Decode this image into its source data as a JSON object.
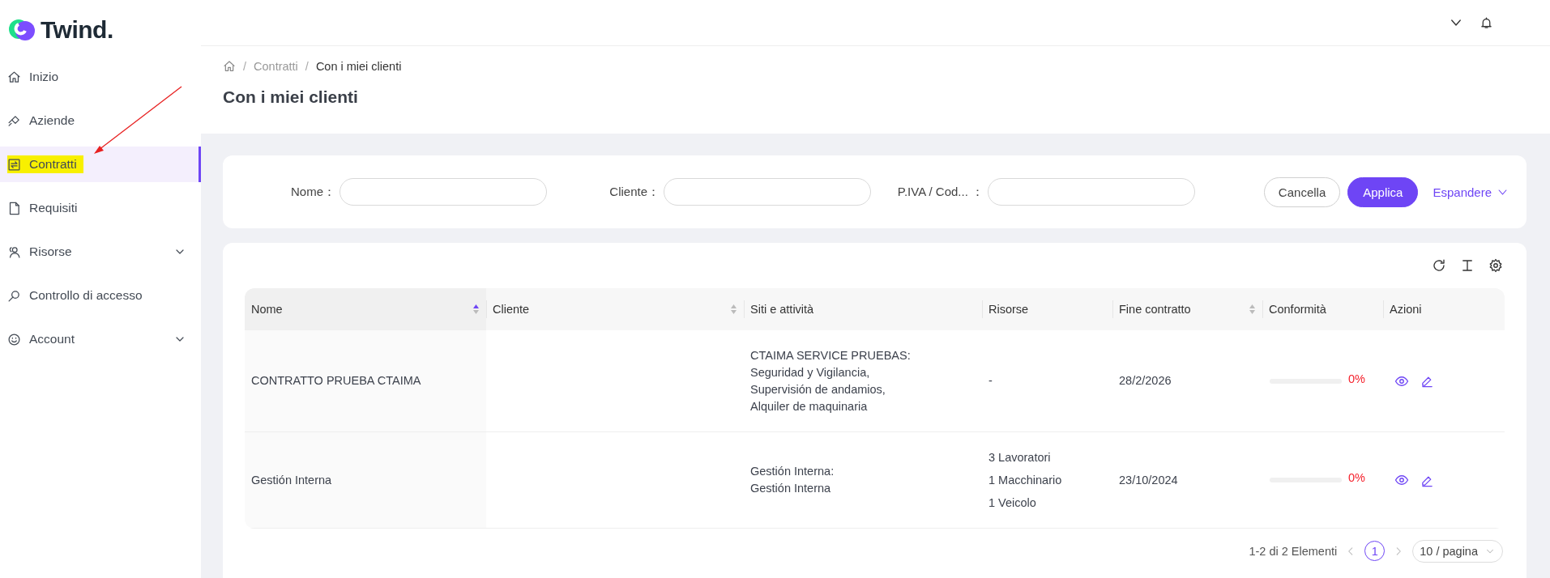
{
  "sidebar": {
    "logo": "Twind.",
    "items": [
      {
        "label": "Inizio",
        "selected": false,
        "expandable": false,
        "highlighted": false
      },
      {
        "label": "Aziende",
        "selected": false,
        "expandable": false,
        "highlighted": false
      },
      {
        "label": "Contratti",
        "selected": true,
        "expandable": false,
        "highlighted": true
      },
      {
        "label": "Requisiti",
        "selected": false,
        "expandable": false,
        "highlighted": false
      },
      {
        "label": "Risorse",
        "selected": false,
        "expandable": true,
        "highlighted": false
      },
      {
        "label": "Controllo di accesso",
        "selected": false,
        "expandable": false,
        "highlighted": false
      },
      {
        "label": "Account",
        "selected": false,
        "expandable": true,
        "highlighted": false
      }
    ]
  },
  "annotations": [
    {
      "kind": "arrow"
    }
  ],
  "breadcrumb": [
    {
      "separator": "/",
      "label": "Contratti",
      "current": false
    },
    {
      "separator": "/",
      "label": "Con i miei clienti",
      "current": true
    }
  ],
  "page_title": "Con i miei clienti",
  "filters": [
    {
      "label": "Nome："
    },
    {
      "label": "Cliente："
    },
    {
      "label": "P.IVA / Cod... ："
    }
  ],
  "filter_buttons": [
    {
      "label": "Cancella",
      "kind": "default"
    },
    {
      "label": "Applica",
      "kind": "primary"
    },
    {
      "label": "Espandere",
      "kind": "link"
    }
  ],
  "table": {
    "columns": [
      {
        "label": "Nome",
        "sortable": true,
        "sorted": true
      },
      {
        "label": "Cliente",
        "sortable": true,
        "sorted": false
      },
      {
        "label": "Siti e attività",
        "sortable": false
      },
      {
        "label": "Risorse",
        "sortable": false
      },
      {
        "label": "Fine contratto",
        "sortable": true,
        "sorted": false
      },
      {
        "label": "Conformità",
        "sortable": false
      },
      {
        "label": "Azioni",
        "sortable": false
      }
    ],
    "rows": [
      {
        "name": "CONTRATTO PRUEBA CTAIMA",
        "sites": "CTAIMA SERVICE PRUEBAS:\nSeguridad y Vigilancia,\nSupervisión de andamios,\nAlquiler de maquinaria",
        "resources": [
          "-"
        ],
        "end_date": "28/2/2026",
        "compliance": {
          "level": 0,
          "reading": "0%"
        }
      },
      {
        "name": "Gestión Interna",
        "sites": "Gestión Interna:\nGestión Interna",
        "resources": [
          "3 Lavoratori",
          "1 Macchinario",
          "1 Veicolo"
        ],
        "end_date": "23/10/2024",
        "compliance": {
          "level": 0,
          "reading": "0%"
        }
      }
    ]
  },
  "pagination": {
    "summary": "1-2 di 2 Elementi",
    "pages": [
      {
        "label": "1",
        "selected": true
      }
    ],
    "page_size": "10 / pagina"
  }
}
